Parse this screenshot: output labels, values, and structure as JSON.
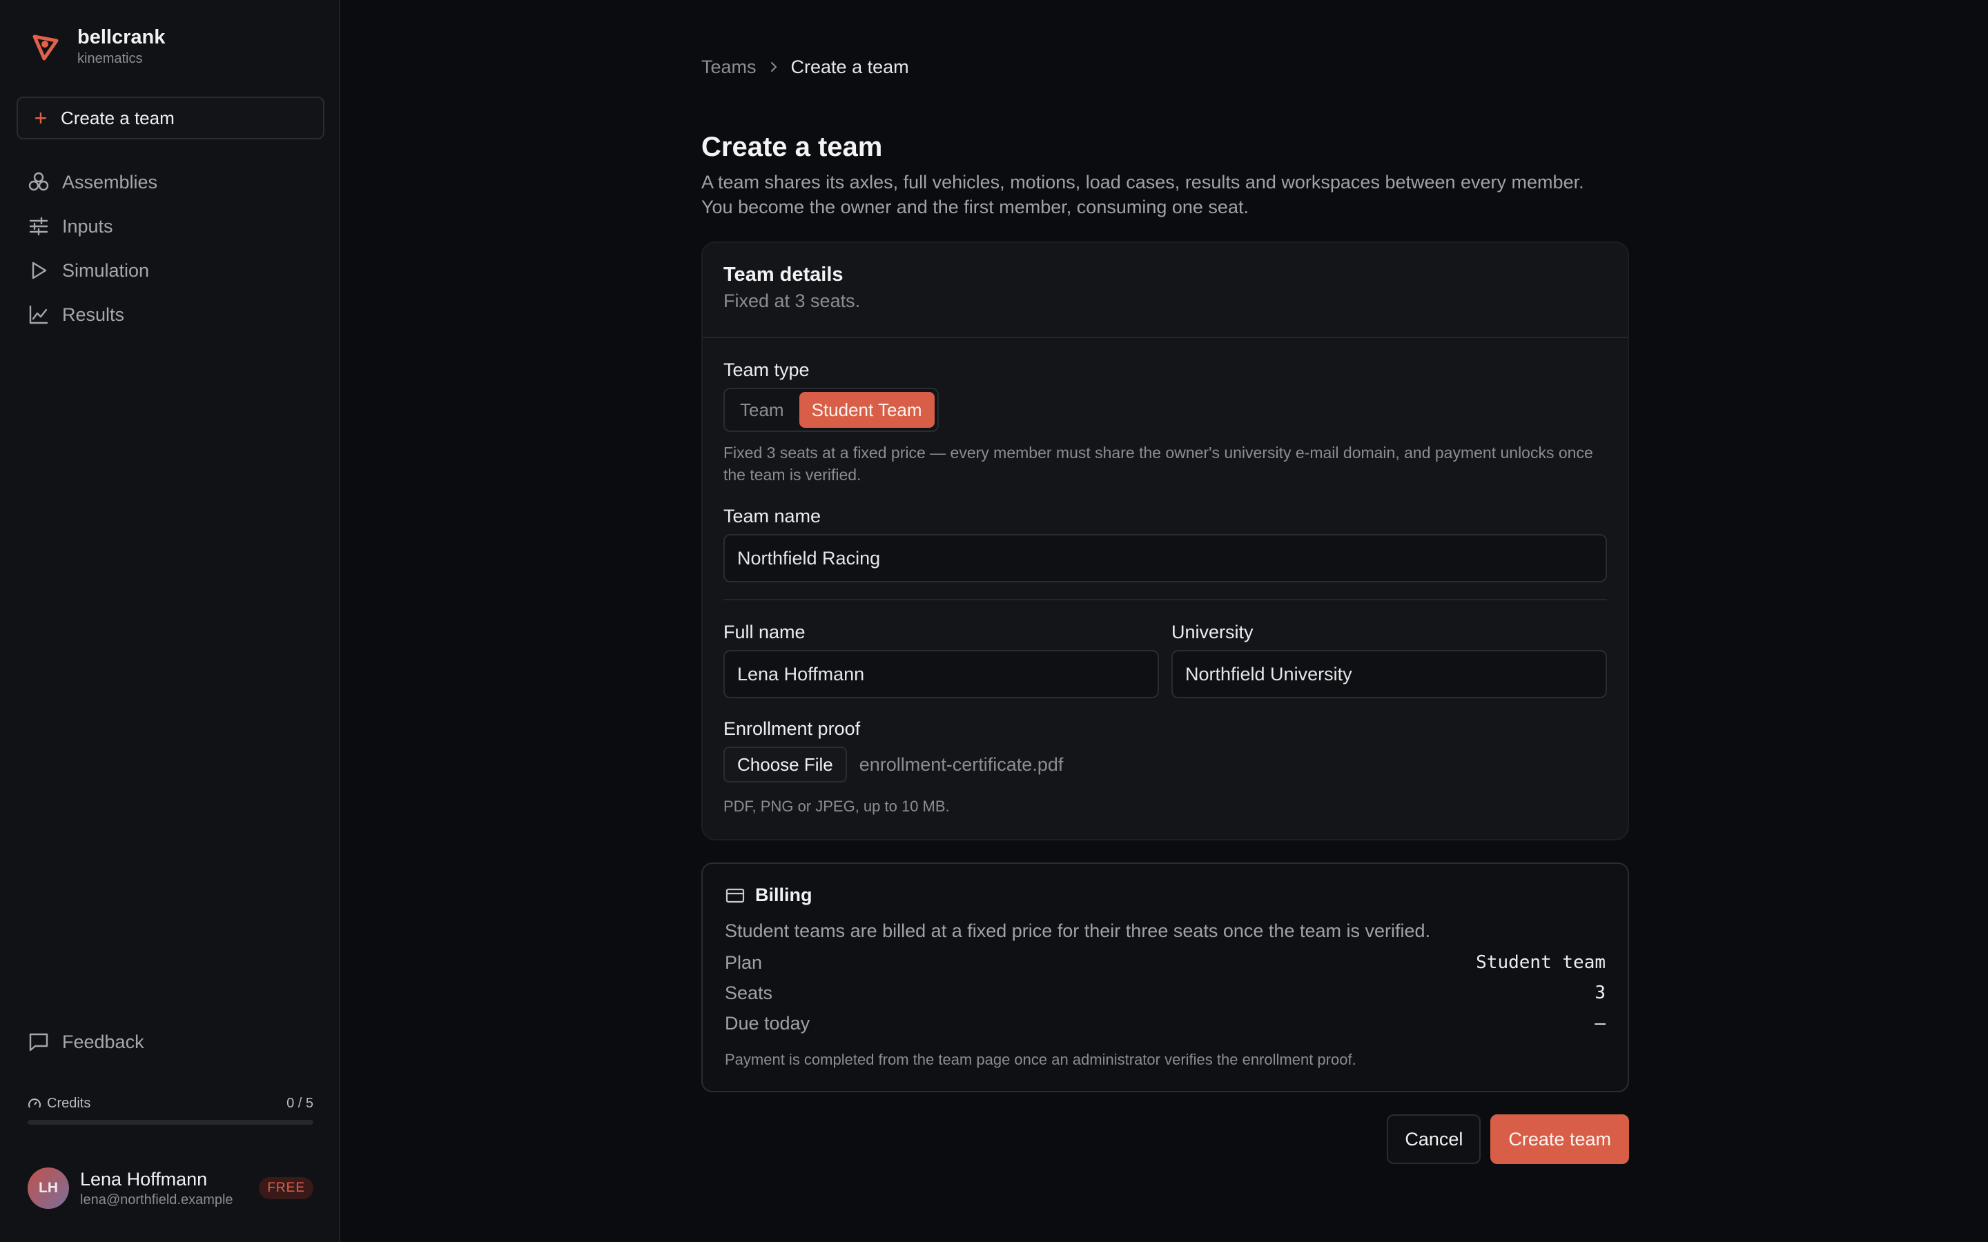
{
  "brand": {
    "name": "bellcrank",
    "subtitle": "kinematics",
    "accent": "#e2614a"
  },
  "sidebar": {
    "create_label": "Create a team",
    "items": [
      {
        "label": "Assemblies",
        "icon": "assemblies-icon"
      },
      {
        "label": "Inputs",
        "icon": "sliders-icon"
      },
      {
        "label": "Simulation",
        "icon": "play-icon"
      },
      {
        "label": "Results",
        "icon": "chart-icon"
      }
    ],
    "feedback_label": "Feedback",
    "credits": {
      "label": "Credits",
      "value": "0 / 5",
      "used": 0,
      "total": 5
    },
    "user": {
      "initials": "LH",
      "name": "Lena Hoffmann",
      "email": "lena@northfield.example",
      "plan_badge": "FREE"
    }
  },
  "breadcrumb": {
    "parent": "Teams",
    "current": "Create a team"
  },
  "page": {
    "title": "Create a team",
    "description_1": "A team shares its axles, full vehicles, motions, load cases, results and workspaces between every member.",
    "description_2": "You become the owner and the first member, consuming one seat."
  },
  "team_details": {
    "title": "Team details",
    "subtitle": "Fixed at 3 seats.",
    "team_type_label": "Team type",
    "team_type_options": [
      "Team",
      "Student Team"
    ],
    "team_type_selected": "Student Team",
    "team_type_hint": "Fixed 3 seats at a fixed price — every member must share the owner's university e-mail domain, and payment unlocks once the team is verified.",
    "team_name_label": "Team name",
    "team_name_value": "Northfield Racing",
    "full_name_label": "Full name",
    "full_name_value": "Lena Hoffmann",
    "university_label": "University",
    "university_value": "Northfield University",
    "enrollment_label": "Enrollment proof",
    "choose_file_label": "Choose File",
    "file_name": "enrollment-certificate.pdf",
    "file_hint": "PDF, PNG or JPEG, up to 10 MB."
  },
  "billing": {
    "title": "Billing",
    "description": "Student teams are billed at a fixed price for their three seats once the team is verified.",
    "rows": [
      {
        "key": "Plan",
        "value": "Student team"
      },
      {
        "key": "Seats",
        "value": "3"
      },
      {
        "key": "Due today",
        "value": "—"
      }
    ],
    "note": "Payment is completed from the team page once an administrator verifies the enrollment proof."
  },
  "actions": {
    "cancel": "Cancel",
    "submit": "Create team"
  }
}
